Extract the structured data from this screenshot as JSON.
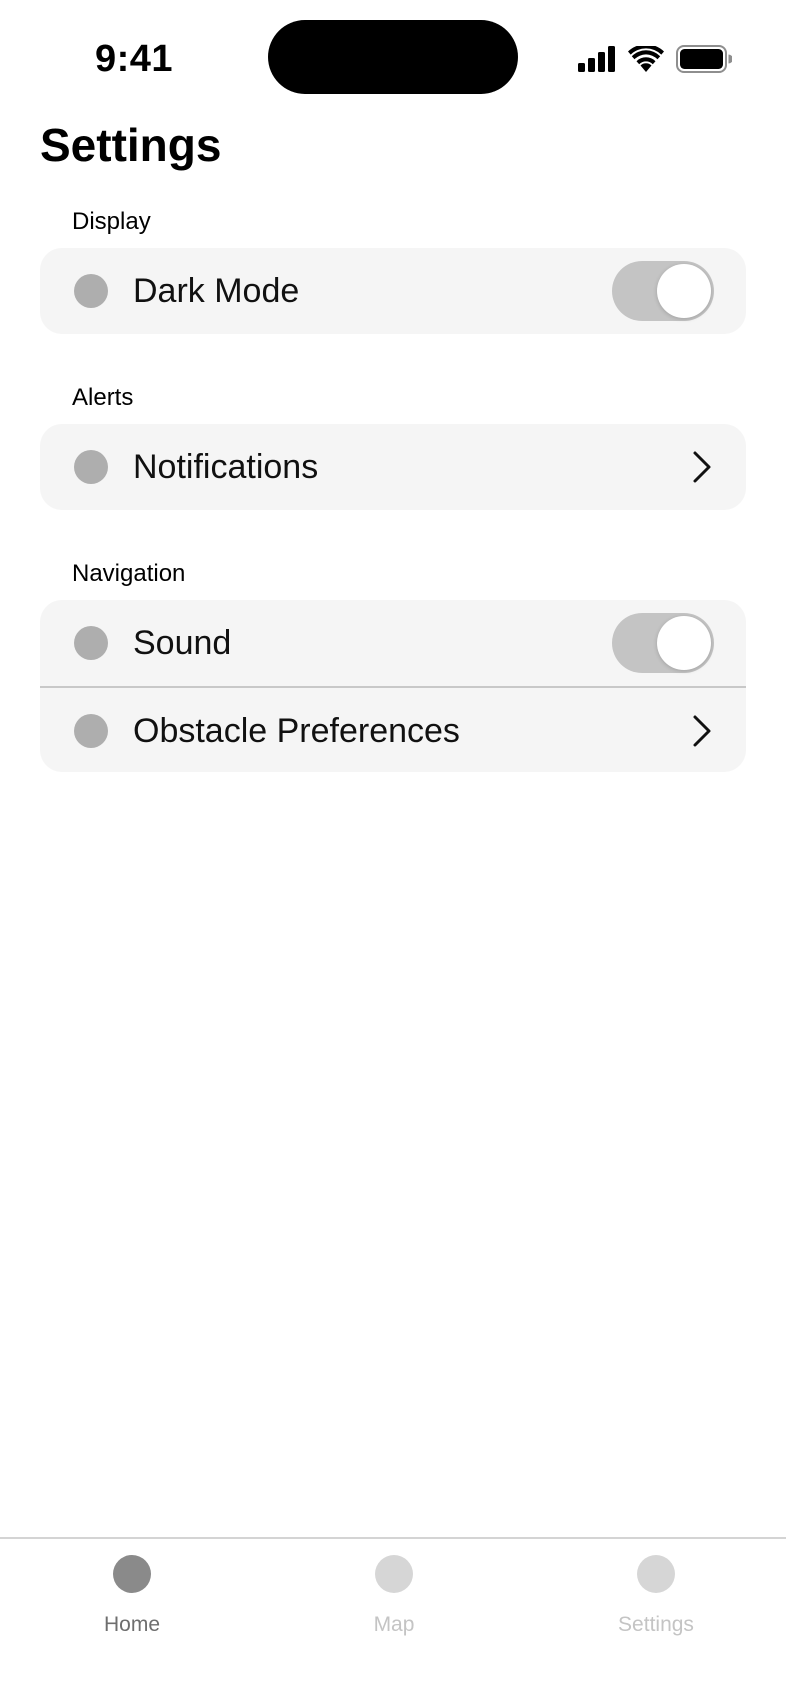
{
  "status_bar": {
    "time": "9:41",
    "icons": [
      "cellular-signal-icon",
      "wifi-icon",
      "battery-icon"
    ]
  },
  "page": {
    "title": "Settings"
  },
  "sections": {
    "display": {
      "label": "Display",
      "rows": [
        {
          "label": "Dark Mode",
          "control": "toggle",
          "on": true
        }
      ]
    },
    "alerts": {
      "label": "Alerts",
      "rows": [
        {
          "label": "Notifications",
          "control": "chevron"
        }
      ]
    },
    "navigation": {
      "label": "Navigation",
      "rows": [
        {
          "label": "Sound",
          "control": "toggle",
          "on": true
        },
        {
          "label": "Obstacle Preferences",
          "control": "chevron"
        }
      ]
    }
  },
  "tab_bar": {
    "tabs": [
      {
        "label": "Home",
        "active": true
      },
      {
        "label": "Map",
        "active": false
      },
      {
        "label": "Settings",
        "active": false
      }
    ]
  },
  "colors": {
    "card_background": "#f5f5f5",
    "row_dot": "#aeaeae",
    "toggle_track": "#c4c4c4",
    "tab_active_icon": "#8a8a8a",
    "tab_active_label": "#6e6e6e",
    "tab_inactive_icon": "#d6d6d6",
    "tab_inactive_label": "#c4c4c4"
  }
}
